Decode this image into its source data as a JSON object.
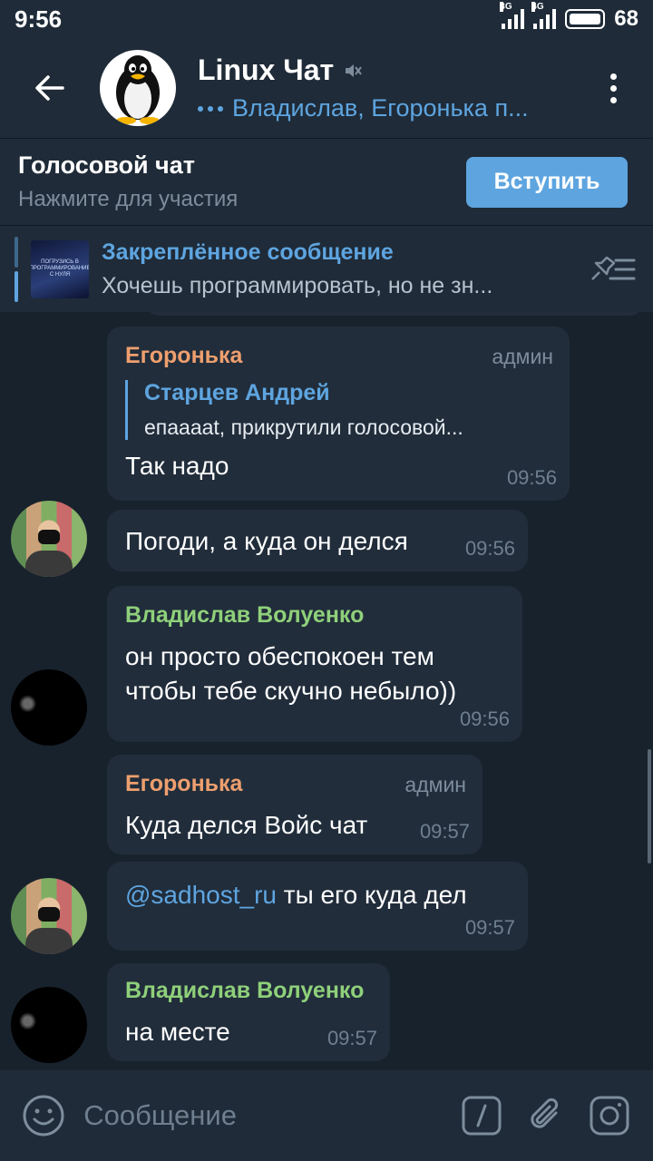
{
  "status_bar": {
    "time": "9:56",
    "net1": "3G",
    "net2": "4G",
    "battery": "68"
  },
  "header": {
    "title": "Linux Чат",
    "subtitle": "Владислав, Егоронька п..."
  },
  "voice_chat": {
    "title": "Голосовой чат",
    "subtitle": "Нажмите для участия",
    "join_label": "Вступить"
  },
  "pinned": {
    "title": "Закреплённое сообщение",
    "text": "Хочешь программировать, но не зн...",
    "thumb_text": "ПОГРУЗИСЬ В ПРОГРАММИРОВАНИЕ С НУЛЯ"
  },
  "messages": [
    {
      "sender": "Егоронька",
      "role": "админ",
      "reply_name": "Старцев Андрей",
      "reply_text": "епааааt, прикрутили голосовой...",
      "text": "Так надо",
      "time": "09:56"
    },
    {
      "text": "Погоди, а куда он делся",
      "time": "09:56"
    },
    {
      "sender": "Владислав Волуенко",
      "text_line1": "он просто обеспокоен тем",
      "text_line2": "чтобы тебе скучно небыло))",
      "time": "09:56"
    },
    {
      "sender": "Егоронька",
      "role": "админ",
      "text": "Куда делся Войс чат",
      "time": "09:57"
    },
    {
      "mention": "@sadhost_ru",
      "text": " ты его куда дел",
      "time": "09:57"
    },
    {
      "sender": "Владислав Волуенко",
      "text": "на месте",
      "time": "09:57"
    }
  ],
  "input": {
    "placeholder": "Сообщение"
  },
  "colors": {
    "accent": "#5ea5e0",
    "admin_name": "#ee9f6e",
    "member_name": "#8fd07a",
    "bubble": "#212d3b",
    "background": "#18222d"
  }
}
